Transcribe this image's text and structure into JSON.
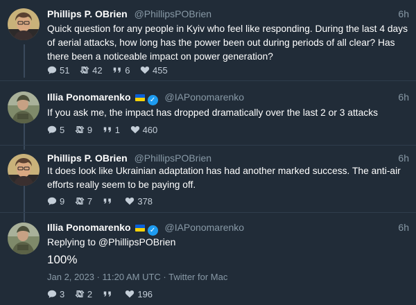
{
  "tweets": [
    {
      "name": "Phillips P. OBrien",
      "handle": "@PhillipsPOBrien",
      "time": "6h",
      "text": "Quick question for any people in Kyiv who feel like responding. During the last 4 days of aerial attacks, how long has the power been out during periods of all clear? Has there been a noticeable impact on power generation?",
      "replies": "51",
      "retweets": "42",
      "quotes": "6",
      "likes": "455"
    },
    {
      "name": "Illia Ponomarenko",
      "handle": "@IAPonomarenko",
      "time": "6h",
      "text": "If you ask me, the impact has dropped dramatically over the last 2 or 3 attacks",
      "replies": "5",
      "retweets": "9",
      "quotes": "1",
      "likes": "460"
    },
    {
      "name": "Phillips P. OBrien",
      "handle": "@PhillipsPOBrien",
      "time": "6h",
      "text": "It does look like Ukrainian adaptation has had another marked success. The anti-air efforts really seem to be paying off.",
      "replies": "9",
      "retweets": "7",
      "quotes": "",
      "likes": "378"
    },
    {
      "name": "Illia Ponomarenko",
      "handle": "@IAPonomarenko",
      "time": "6h",
      "replying_to": "Replying to @PhillipsPOBrien",
      "text": "100%",
      "timestamp": "Jan 2, 2023 · 11:20 AM UTC · Twitter for Mac",
      "replies": "3",
      "retweets": "2",
      "quotes": "",
      "likes": "196"
    }
  ],
  "icons": {
    "reply": "speech-bubble-icon",
    "retweet": "retweet-arrows-icon",
    "quote": "quote-marks-icon",
    "like": "heart-icon",
    "verified": "verified-badge-icon",
    "flag": "ukraine-flag-icon"
  },
  "colors": {
    "background": "#212c38",
    "muted": "#8899a6",
    "verified": "#1d9bf0"
  }
}
